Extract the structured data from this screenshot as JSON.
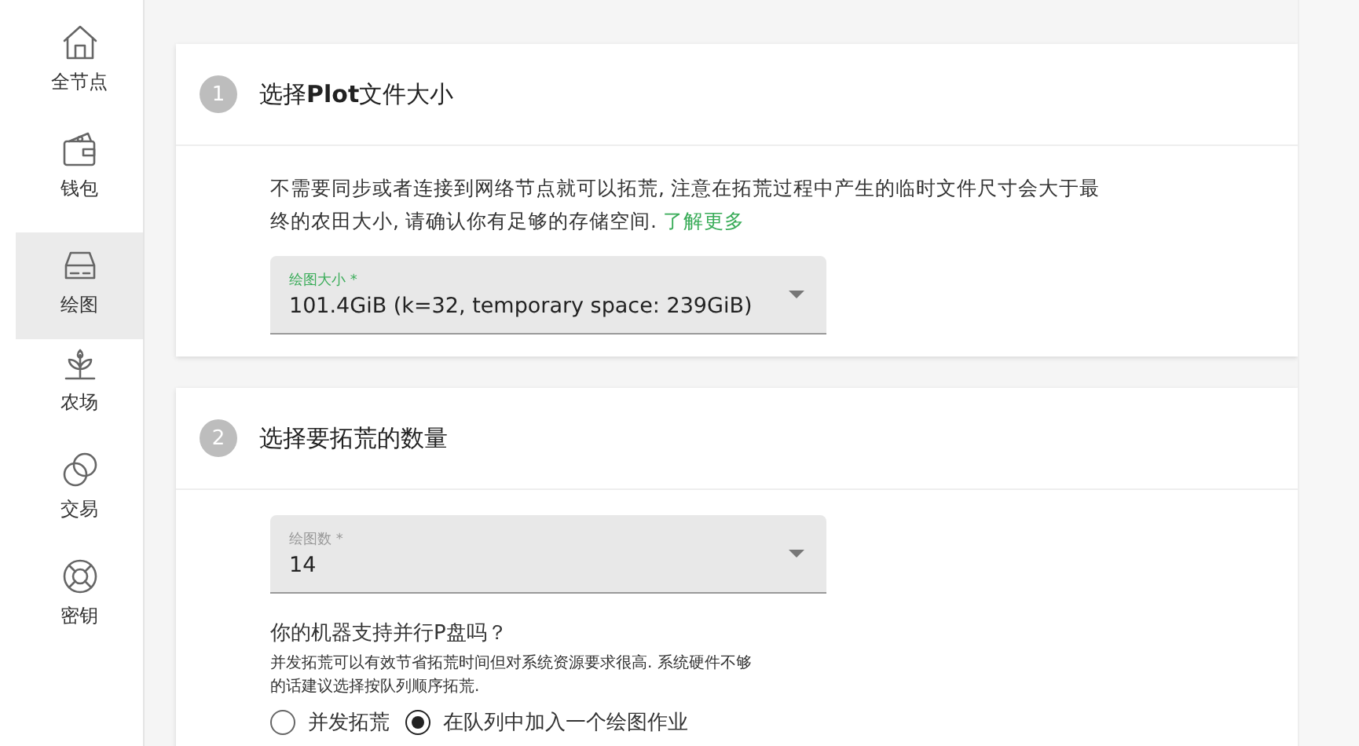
{
  "sidebar": {
    "items": [
      {
        "label": "全节点",
        "selected": false
      },
      {
        "label": "钱包",
        "selected": false
      },
      {
        "label": "绘图",
        "selected": true
      },
      {
        "label": "农场",
        "selected": false
      },
      {
        "label": "交易",
        "selected": false
      },
      {
        "label": "密钥",
        "selected": false
      }
    ]
  },
  "steps": [
    {
      "number": "1",
      "title": "选择**Plot**文件大小",
      "description": "不需要同步或者连接到网络节点就可以拓荒, 注意在拓荒过程中产生的临时文件尺寸会大于最终的农田大小, 请确认你有足够的存储空间.",
      "link": "了解更多",
      "field": {
        "label": "绘图大小 *",
        "value": "101.4GiB (k=32, temporary space: 239GiB)",
        "focused": true
      }
    },
    {
      "number": "2",
      "title": "选择要拓荒的数量",
      "field": {
        "label": "绘图数 *",
        "value": "14",
        "focused": false
      },
      "question": "你的机器支持并行P盘吗？",
      "hint": "并发拓荒可以有效节省拓荒时间但对系统资源要求很高. 系统硬件不够的话建议选择按队列顺序拓荒.",
      "options": [
        {
          "label": "并发拓荒",
          "selected": false
        },
        {
          "label": "在队列中加入一个绘图作业",
          "selected": true
        }
      ]
    }
  ]
}
